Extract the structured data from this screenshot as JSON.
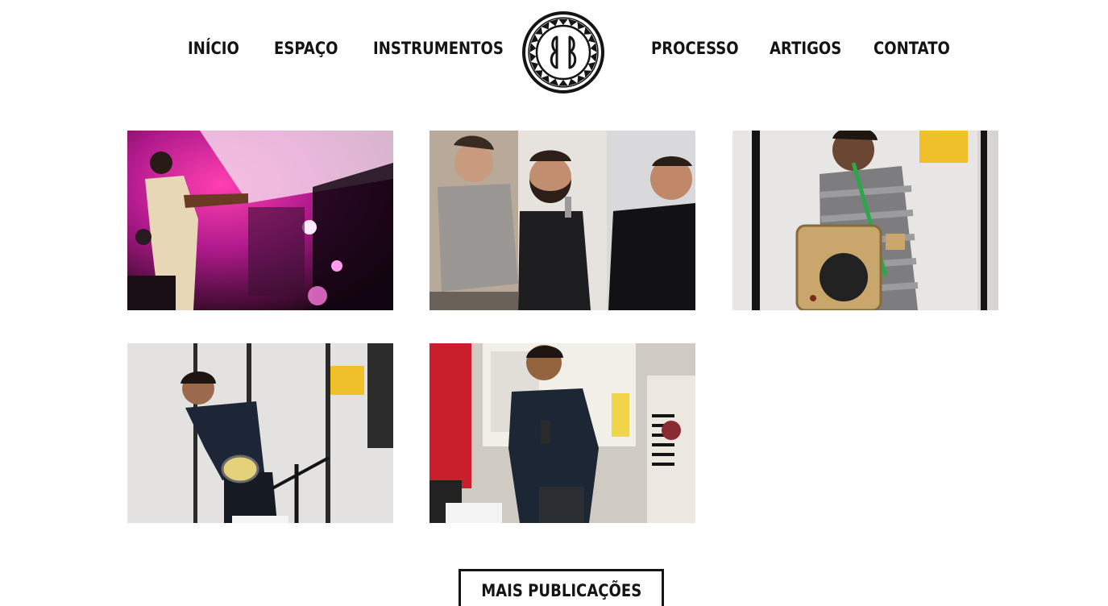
{
  "nav": {
    "left": [
      {
        "label": "INÍCIO"
      },
      {
        "label": "ESPAÇO"
      },
      {
        "label": "INSTRUMENTOS"
      }
    ],
    "logo_text": "BB",
    "right": [
      {
        "label": "PROCESSO"
      },
      {
        "label": "ARTIGOS"
      },
      {
        "label": "CONTATO"
      }
    ]
  },
  "posts": [
    {
      "image": "musician-playing-violin-on-stage-pink-lights"
    },
    {
      "image": "three-men-at-workshop-one-with-microphone"
    },
    {
      "image": "man-with-wooden-box-speaker-instrument"
    },
    {
      "image": "man-playing-tambourine-with-microphone-stand"
    },
    {
      "image": "man-speaking-with-microphone-in-front-of-projection"
    }
  ],
  "more_button": {
    "label": "MAIS PUBLICAÇÕES"
  },
  "colors": {
    "text": "#141414",
    "background": "#ffffff"
  }
}
